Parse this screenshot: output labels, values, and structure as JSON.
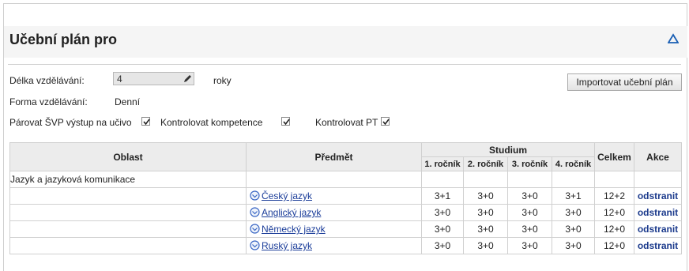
{
  "panel": {
    "title": "Učební plán pro"
  },
  "form": {
    "length_label": "Délka vzdělávání:",
    "length_value": "4",
    "length_unit": "roky",
    "form_label": "Forma vzdělávání:",
    "form_value": "Denní",
    "import_button": "Importovat učební plán",
    "checkboxes": [
      {
        "label": "Párovat ŠVP výstup na učivo",
        "checked": true
      },
      {
        "label": "Kontrolovat kompetence",
        "checked": true
      },
      {
        "label": "Kontrolovat PT",
        "checked": true
      }
    ]
  },
  "table": {
    "headers": {
      "area": "Oblast",
      "subject": "Předmět",
      "study": "Studium",
      "years": [
        "1. ročník",
        "2. ročník",
        "3. ročník",
        "4. ročník"
      ],
      "total": "Celkem",
      "action": "Akce"
    },
    "area_row": "Jazyk a jazyková komunikace",
    "rows": [
      {
        "subject": "Český jazyk",
        "values": [
          "3+1",
          "3+0",
          "3+0",
          "3+1"
        ],
        "total": "12+2",
        "action": "odstranit"
      },
      {
        "subject": "Anglický jazyk",
        "values": [
          "3+0",
          "3+0",
          "3+0",
          "3+0"
        ],
        "total": "12+0",
        "action": "odstranit"
      },
      {
        "subject": "Německý jazyk",
        "values": [
          "3+0",
          "3+0",
          "3+0",
          "3+0"
        ],
        "total": "12+0",
        "action": "odstranit"
      },
      {
        "subject": "Ruský jazyk",
        "values": [
          "3+0",
          "3+0",
          "3+0",
          "3+0"
        ],
        "total": "12+0",
        "action": "odstranit"
      }
    ]
  },
  "colors": {
    "link": "#1a3c99",
    "header_bg": "#ececec",
    "accent": "#1a5fb4"
  }
}
